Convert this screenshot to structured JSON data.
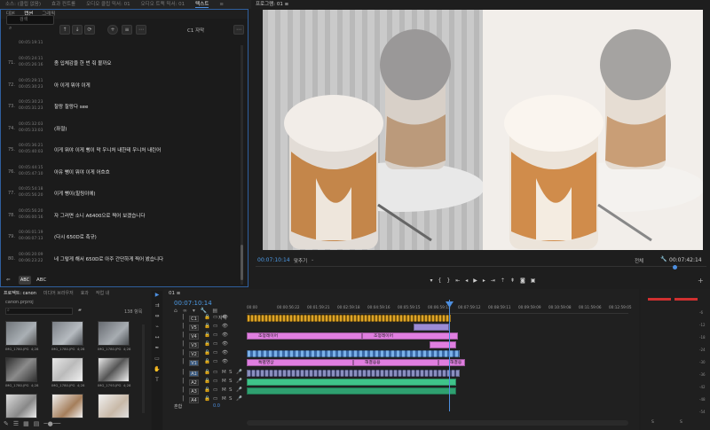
{
  "top_tabs": [
    "소스: (클립 없음)",
    "효과 컨트롤",
    "오디오 클립 믹서: 01",
    "오디오 트랙 믹서: 01",
    "텍스트",
    "≡"
  ],
  "text_panel": {
    "subtabs": [
      "대본",
      "캡션",
      "그래픽"
    ],
    "search_placeholder": "검색",
    "track_label": "C1 자막",
    "captions": [
      {
        "num": "",
        "in": "00:05:19:11",
        "out": "",
        "text": ""
      },
      {
        "num": "71.",
        "in": "00:05:24:11",
        "out": "00:05:26:16",
        "text": "좀 입체감을 한 번 줘 볼까요"
      },
      {
        "num": "72.",
        "in": "00:05:29:11",
        "out": "00:05:30:23",
        "text": "아 이게 뭐야 이게"
      },
      {
        "num": "73.",
        "in": "00:05:30:23",
        "out": "00:05:31:23",
        "text": "찰랑 찰랑다 see"
      },
      {
        "num": "74.",
        "in": "00:05:32:03",
        "out": "00:05:33:03",
        "text": "(좌절)"
      },
      {
        "num": "75.",
        "in": "00:05:36:21",
        "out": "00:05:40:03",
        "text": "이게 뭐야 이게 뻥이 막 우니처 내한테 우니처 내린어"
      },
      {
        "num": "76.",
        "in": "00:05:44:15",
        "out": "00:05:47:10",
        "text": "아유 뻥이 뭐야 이게 어흐흐"
      },
      {
        "num": "77.",
        "in": "00:05:54:18",
        "out": "00:05:56:20",
        "text": "이게 뻥이(힐링이에)"
      },
      {
        "num": "78.",
        "in": "00:05:56:20",
        "out": "00:06:00:16",
        "text": "자 그러면 소니 A6400으로 찍어 보겠습니다"
      },
      {
        "num": "79.",
        "in": "00:06:01:19",
        "out": "00:06:07:13",
        "text": "(다시 650D로 촉규)"
      },
      {
        "num": "80.",
        "in": "00:06:20:09",
        "out": "00:06:23:22",
        "text": "네 그렇게 해서 650D로 아주 간단하게 찍어 봤습니다"
      }
    ],
    "bottom": [
      "ABC",
      "ABC"
    ]
  },
  "program": {
    "title": "프로그램: 01 ≡",
    "timecode": "00:07:10:14",
    "fit": "맞추기",
    "quality": "전체",
    "duration": "00:07:42:14"
  },
  "project": {
    "tabs": [
      "프로젝트: canon",
      "미디어 브라우저",
      "효과",
      "작업 내"
    ],
    "name": "canon.prproj",
    "count": "138 항목",
    "items": [
      {
        "name": "IMG_1780.JPG",
        "dur": "4;28"
      },
      {
        "name": "IMG_1780.JPG",
        "dur": "4;28"
      },
      {
        "name": "IMG_1780.JPG",
        "dur": "4;28"
      },
      {
        "name": "IMG_1780.JPG",
        "dur": "4;28"
      },
      {
        "name": "IMG_1780.JPG",
        "dur": "4;28"
      },
      {
        "name": "IMG_1793.JPG",
        "dur": "4;28"
      },
      {
        "name": "",
        "dur": ""
      },
      {
        "name": "",
        "dur": ""
      },
      {
        "name": "",
        "dur": ""
      }
    ]
  },
  "timeline": {
    "title": "01 ≡",
    "timecode": "00:07:10:14",
    "ruler": [
      "00:00",
      "00:00:56:22",
      "00:01:59:21",
      "00:02:59:18",
      "00:04:59:16",
      "00:05:59:15",
      "00:06:59:13",
      "00:07:59:12",
      "00:08:59:11",
      "00:09:59:09",
      "00:10:59:08",
      "00:11:59:06",
      "00:12:59:05"
    ],
    "tracks": [
      "C1",
      "V5",
      "V4",
      "V3",
      "V2",
      "V1",
      "A1",
      "A2",
      "A3",
      "A4"
    ],
    "caption_track_label": "자막",
    "master": "혼합",
    "master_val": "0.0",
    "clip_labels": [
      "조정",
      "조정레이어",
      "조정레이어",
      "특별영상",
      "해결응용",
      "해결응"
    ]
  },
  "meter": {
    "labels": [
      "-6",
      "-12",
      "-18",
      "-24",
      "-30",
      "-36",
      "-42",
      "-48",
      "-54"
    ],
    "footer": [
      "S",
      "S"
    ]
  }
}
